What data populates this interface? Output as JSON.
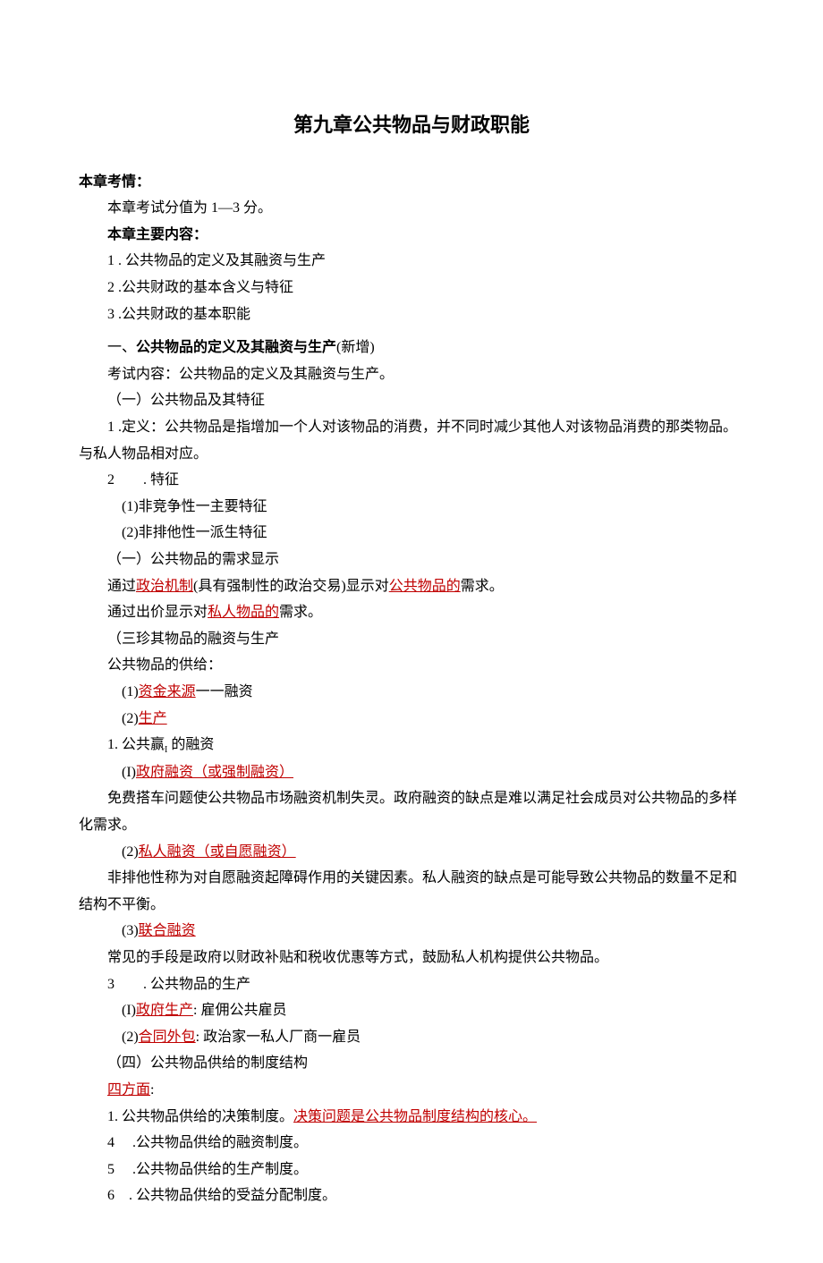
{
  "title": "第九章公共物品与财政职能",
  "s_kaoqing_hdr": "本章考情：",
  "s_kaoqing_line": "本章考试分值为 1—3 分。",
  "s_main_hdr": "本章主要内容：",
  "toc1": "1 . 公共物品的定义及其融资与生产",
  "toc2": "2  .公共财政的基本含义与特征",
  "toc3": "3  .公共财政的基本职能",
  "sec1_heading_pre": "一、",
  "sec1_heading_bold": "公共物品的定义及其融资与生产",
  "sec1_heading_tail": "(新增)",
  "exam_content": "考试内容：公共物品的定义及其融资与生产。",
  "h_1_1": "（一）公共物品及其特征",
  "def_line": "1 .定义：公共物品是指增加一个人对该物品的消费，并不同时减少其他人对该物品消费的那类物品。与私人物品相对应。",
  "feat_hdr": "2  . 特征",
  "feat_1": "(1)非竞争性一主要特征",
  "feat_2": "(2)非排他性一派生特征",
  "h_1_2": "（一）公共物品的需求显示",
  "demand_1_pre": "通过",
  "demand_1_link": "政治机制",
  "demand_1_mid": "(具有强制性的政治交易)显示对",
  "demand_1_link2": "公共物品的",
  "demand_1_tail": "需求。",
  "demand_2_pre": "通过出价显示对",
  "demand_2_link": "私人物品的",
  "demand_2_tail": "需求。",
  "h_1_3": "（三珍其物品的融资与生产",
  "supply_hdr": "公共物品的供给：",
  "supply_1_pre": "(1)",
  "supply_1_link": "资金来源",
  "supply_1_tail": "一一融资",
  "supply_2_pre": "(2)",
  "supply_2_link": "生产",
  "fin_goods_hdr_pre": "1. 公共赢",
  "fin_goods_hdr_sub": "I",
  "fin_goods_hdr_tail": " 的融资",
  "fin_1_pre": "(I)",
  "fin_1_link": "政府融资（或强制融资）",
  "fin_1_body": "免费搭车问题使公共物品市场融资机制失灵。政府融资的缺点是难以满足社会成员对公共物品的多样化需求。",
  "fin_2_pre": "(2)",
  "fin_2_link": "私人融资（或自愿融资）",
  "fin_2_body": "非排他性称为对自愿融资起障碍作用的关键因素。私人融资的缺点是可能导致公共物品的数量不足和结构不平衡。",
  "fin_3_pre": "(3)",
  "fin_3_link": "联合融资",
  "fin_3_body": "常见的手段是政府以财政补贴和税收优惠等方式，鼓励私人机构提供公共物品。",
  "prod_hdr": "3  . 公共物品的生产",
  "prod_1_pre": "(I)",
  "prod_1_link": "政府生产",
  "prod_1_tail": ": 雇佣公共雇员",
  "prod_2_pre": "(2)",
  "prod_2_link": "合同外包",
  "prod_2_tail": ": 政治家一私人厂商一雇员",
  "inst_hdr": "（四）公共物品供给的制度结构",
  "four_aspects": "四方面",
  "colon": ":",
  "inst_1_pre": "1. 公共物品供给的决策制度。",
  "inst_1_link": "决策问题是公共物品制度结构的核心。",
  "inst_2": "4  .公共物品供给的融资制度。",
  "inst_3": "5  .公共物品供给的生产制度。",
  "inst_4": "6 . 公共物品供给的受益分配制度。"
}
